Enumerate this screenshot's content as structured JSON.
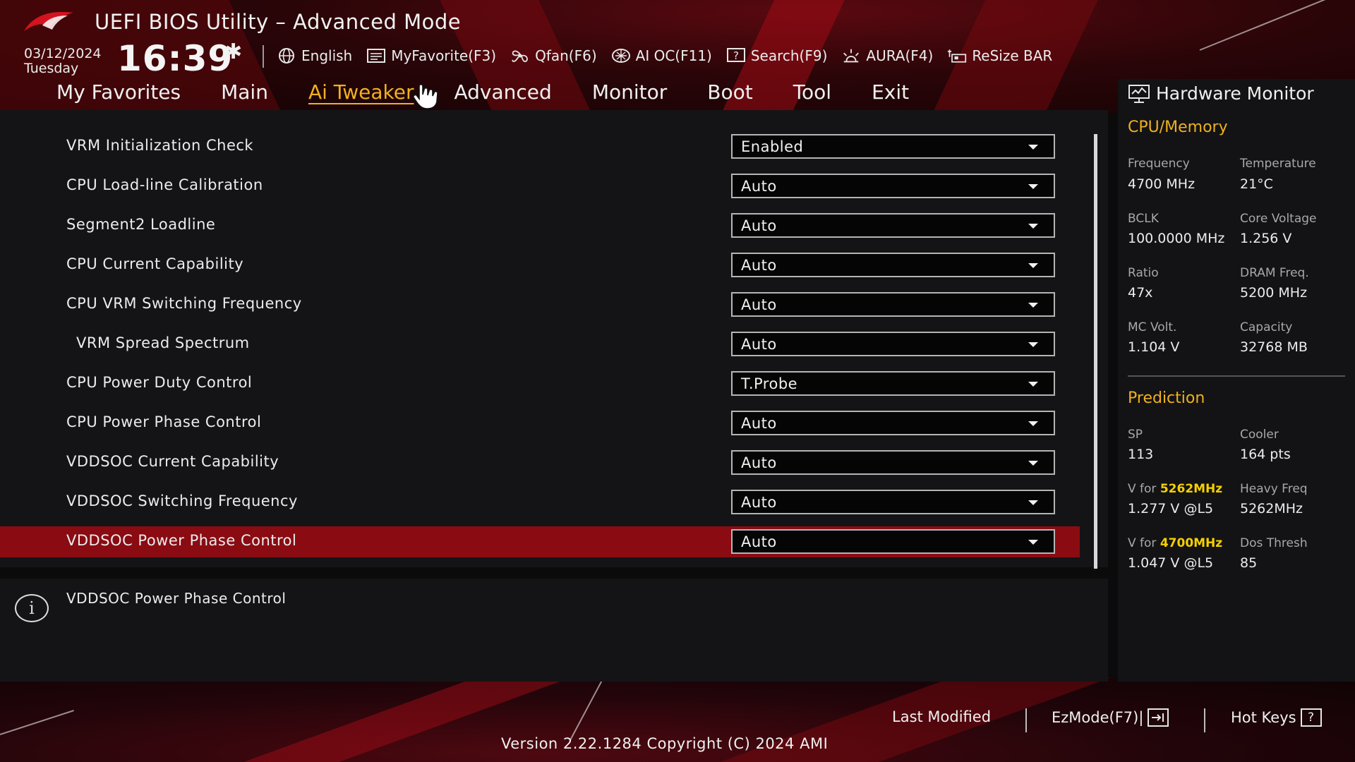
{
  "header": {
    "title": "UEFI BIOS Utility – Advanced Mode",
    "date": "03/12/2024",
    "day": "Tuesday",
    "time": "16:39"
  },
  "toolbar": [
    {
      "label": "English",
      "icon": "globe-icon"
    },
    {
      "label": "MyFavorite(F3)",
      "icon": "favorite-list-icon"
    },
    {
      "label": "Qfan(F6)",
      "icon": "fan-icon"
    },
    {
      "label": "AI OC(F11)",
      "icon": "ai-chip-icon"
    },
    {
      "label": "Search(F9)",
      "icon": "search-help-icon"
    },
    {
      "label": "AURA(F4)",
      "icon": "aura-light-icon"
    },
    {
      "label": "ReSize BAR",
      "icon": "resize-bar-icon"
    }
  ],
  "nav": {
    "tabs": [
      "My Favorites",
      "Main",
      "Ai Tweaker",
      "Advanced",
      "Monitor",
      "Boot",
      "Tool",
      "Exit"
    ],
    "active_index": 2
  },
  "settings": [
    {
      "label": "VRM Initialization Check",
      "value": "Enabled",
      "indent": false
    },
    {
      "label": "CPU Load-line Calibration",
      "value": "Auto",
      "indent": false
    },
    {
      "label": "Segment2 Loadline",
      "value": "Auto",
      "indent": false
    },
    {
      "label": "CPU Current Capability",
      "value": "Auto",
      "indent": false
    },
    {
      "label": "CPU VRM Switching Frequency",
      "value": "Auto",
      "indent": false
    },
    {
      "label": "VRM Spread Spectrum",
      "value": "Auto",
      "indent": true
    },
    {
      "label": "CPU Power Duty Control",
      "value": "T.Probe",
      "indent": false
    },
    {
      "label": "CPU Power Phase Control",
      "value": "Auto",
      "indent": false
    },
    {
      "label": "VDDSOC Current Capability",
      "value": "Auto",
      "indent": false
    },
    {
      "label": "VDDSOC Switching Frequency",
      "value": "Auto",
      "indent": false
    },
    {
      "label": "VDDSOC Power Phase Control",
      "value": "Auto",
      "indent": false,
      "selected": true
    }
  ],
  "help": {
    "text": "VDDSOC Power Phase Control"
  },
  "hardware_monitor": {
    "title": "Hardware Monitor",
    "cpu_memory": {
      "title": "CPU/Memory",
      "frequency_label": "Frequency",
      "frequency": "4700 MHz",
      "temperature_label": "Temperature",
      "temperature": "21°C",
      "bclk_label": "BCLK",
      "bclk": "100.0000 MHz",
      "core_voltage_label": "Core Voltage",
      "core_voltage": "1.256 V",
      "ratio_label": "Ratio",
      "ratio": "47x",
      "dram_freq_label": "DRAM Freq.",
      "dram_freq": "5200 MHz",
      "mc_volt_label": "MC Volt.",
      "mc_volt": "1.104 V",
      "capacity_label": "Capacity",
      "capacity": "32768 MB"
    },
    "prediction": {
      "title": "Prediction",
      "sp_label": "SP",
      "sp": "113",
      "cooler_label": "Cooler",
      "cooler": "164 pts",
      "v_for_prefix": "V for",
      "v1_freq": "5262MHz",
      "v1": "1.277 V @L5",
      "heavy_freq_label": "Heavy Freq",
      "heavy_freq": "5262MHz",
      "v2_freq": "4700MHz",
      "v2": "1.047 V @L5",
      "dos_thresh_label": "Dos Thresh",
      "dos_thresh": "85"
    }
  },
  "footer": {
    "last_modified": "Last Modified",
    "ezmode": "EzMode(F7)|",
    "hotkeys": "Hot Keys",
    "hotkeys_icon_text": "?",
    "version": "Version 2.22.1284 Copyright (C) 2024 AMI"
  },
  "colors": {
    "accent": "#f0b020",
    "selected_row": "#8a0b12",
    "highlight_freq": "#f5d000"
  }
}
